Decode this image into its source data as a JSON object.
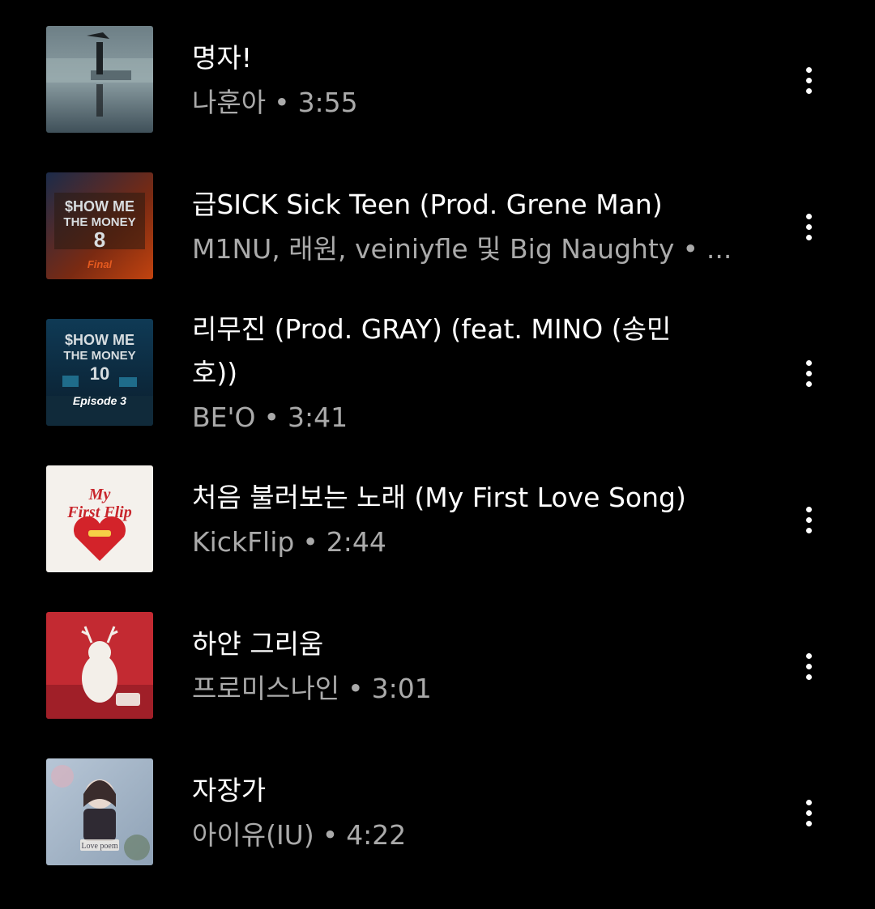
{
  "songs": [
    {
      "title": "명자!",
      "artist": "나훈아",
      "separator": "•",
      "duration": "3:55",
      "art_icon": "album-art-myeongja"
    },
    {
      "title": "급SICK Sick Teen (Prod. Grene Man)",
      "artist": "M1NU, 래원, veiniyfle 및 Big Naughty",
      "separator": "•",
      "duration": "...",
      "art_icon": "album-art-show-me-the-money-8",
      "art_text": [
        "$HOW ME",
        "THE MONEY",
        "8",
        "Final"
      ]
    },
    {
      "title": "리무진 (Prod. GRAY) (feat. MINO (송민호))",
      "artist": "BE'O",
      "separator": "•",
      "duration": "3:41",
      "art_icon": "album-art-show-me-the-money-10",
      "art_text": [
        "$HOW ME",
        "THE MONEY",
        "10",
        "Episode 3"
      ]
    },
    {
      "title": "처음 불러보는 노래 (My First Love Song)",
      "artist": "KickFlip",
      "separator": "•",
      "duration": "2:44",
      "art_icon": "album-art-my-first-flip",
      "art_text": [
        "My",
        "First Flip"
      ]
    },
    {
      "title": "하얀 그리움",
      "artist": "프로미스나인",
      "separator": "•",
      "duration": "3:01",
      "art_icon": "album-art-white-memories"
    },
    {
      "title": "자장가",
      "artist": "아이유(IU)",
      "separator": "•",
      "duration": "4:22",
      "art_icon": "album-art-love-poem",
      "art_text": [
        "Love poem"
      ]
    }
  ],
  "more_icon": "more-vert-icon",
  "colors": {
    "background": "#000000",
    "title": "#ffffff",
    "subtitle": "#aaaaaa"
  }
}
